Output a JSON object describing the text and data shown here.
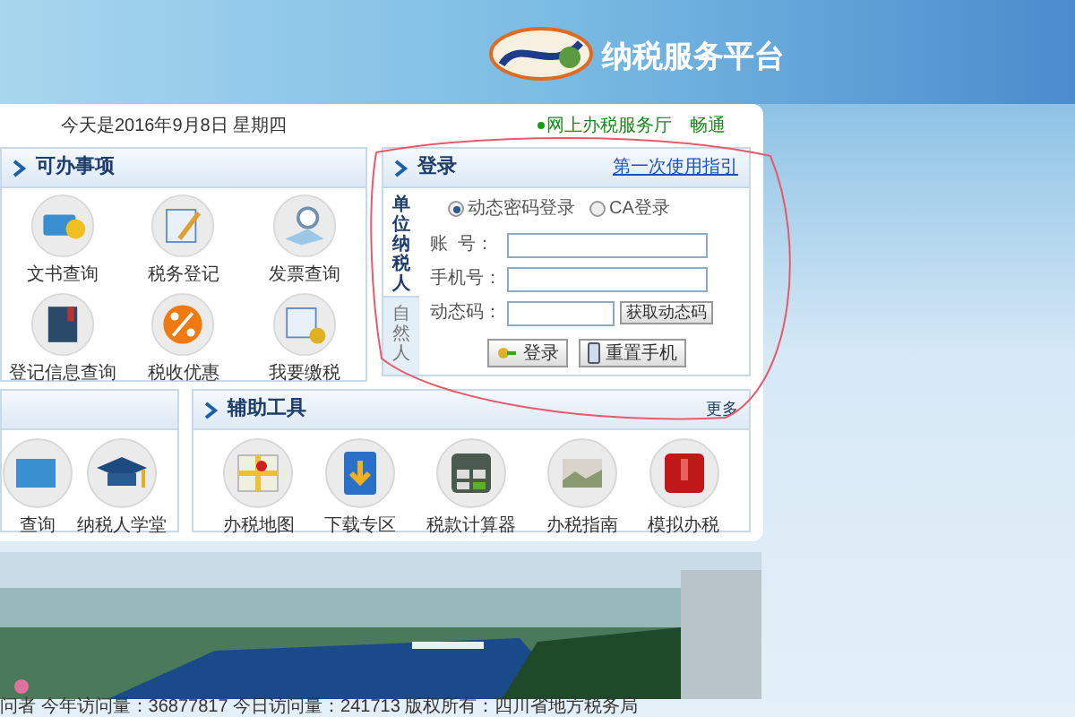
{
  "header": {
    "title": "纳税服务平台"
  },
  "info_bar": {
    "date": "今天是2016年9月8日 星期四",
    "service_link": "网上办税服务厅",
    "status": "畅通"
  },
  "tasks_panel": {
    "title": "可办事项",
    "items": [
      "文书查询",
      "税务登记",
      "发票查询",
      "登记信息查询",
      "税收优惠",
      "我要缴税"
    ]
  },
  "login_panel": {
    "title": "登录",
    "guide_link": "第一次使用指引",
    "side_tabs": [
      {
        "label": "单位纳税人",
        "selected": true
      },
      {
        "label": "自然人",
        "selected": false
      }
    ],
    "modes": [
      {
        "label": "动态密码登录",
        "selected": true
      },
      {
        "label": "CA登录",
        "selected": false
      }
    ],
    "fields": [
      {
        "label": "账  号："
      },
      {
        "label": "手机号："
      },
      {
        "label": "动态码：",
        "button": "获取动态码"
      }
    ],
    "buttons": [
      "登录",
      "重置手机"
    ]
  },
  "left_panel": {
    "items": [
      "查询",
      "纳税人学堂"
    ]
  },
  "tools_panel": {
    "title": "辅助工具",
    "more": "更多",
    "items": [
      "办税地图",
      "下载专区",
      "税款计算器",
      "办税指南",
      "模拟办税"
    ]
  },
  "footer": {
    "text": "问者 今年访问量：36877817 今日访问量：241713 版权所有：四川省地方税务局"
  }
}
